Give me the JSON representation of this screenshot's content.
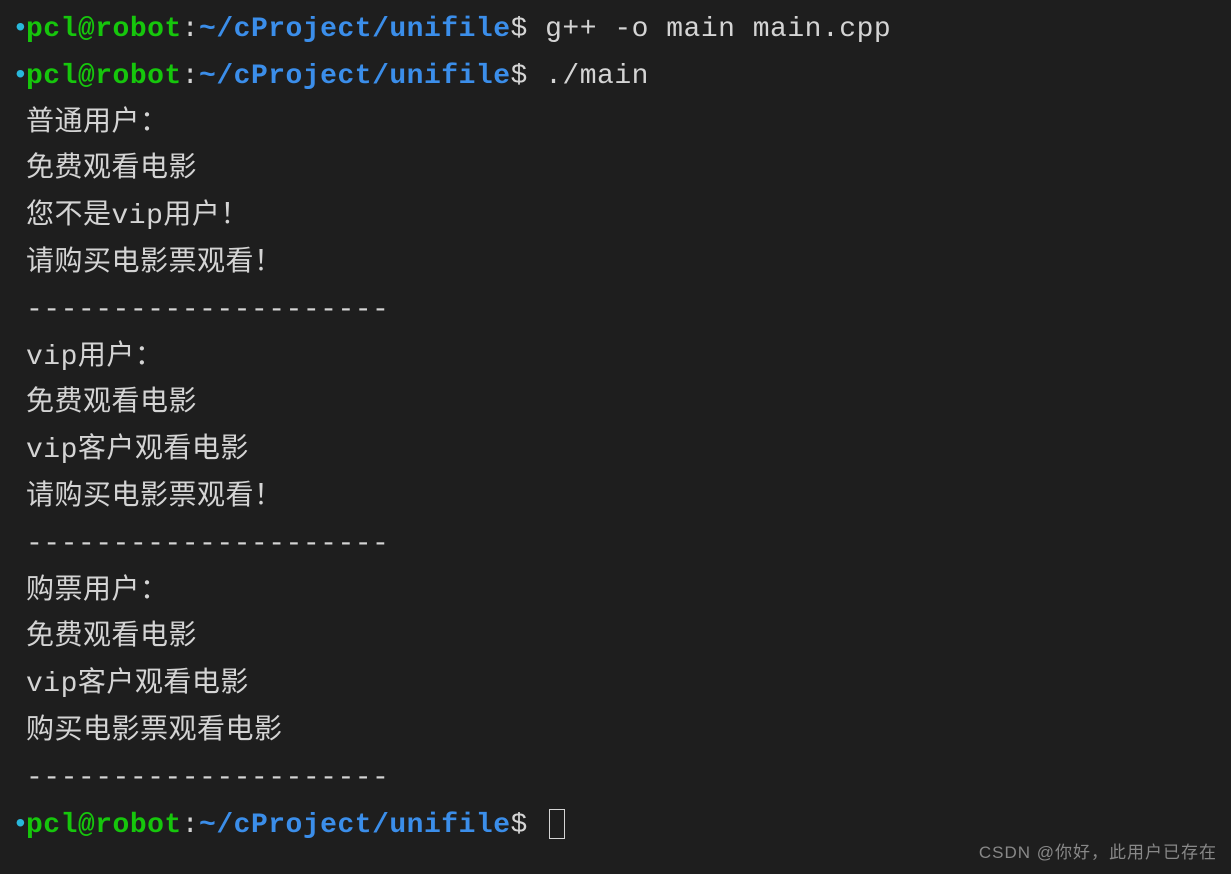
{
  "prompts": [
    {
      "bullet": "•",
      "user_host": "pcl@robot",
      "colon": ":",
      "path": "~/cProject/unifile",
      "dollar": "$",
      "command": "g++ -o main main.cpp"
    },
    {
      "bullet": "•",
      "user_host": "pcl@robot",
      "colon": ":",
      "path": "~/cProject/unifile",
      "dollar": "$",
      "command": "./main"
    }
  ],
  "output_lines": [
    "普通用户：",
    "免费观看电影",
    "您不是vip用户！",
    "请购买电影票观看！",
    "---------------------",
    "vip用户：",
    "免费观看电影",
    "vip客户观看电影",
    "请购买电影票观看！",
    "---------------------",
    "购票用户：",
    "免费观看电影",
    "vip客户观看电影",
    "购买电影票观看电影",
    "---------------------"
  ],
  "final_prompt": {
    "bullet": "•",
    "user_host": "pcl@robot",
    "colon": ":",
    "path": "~/cProject/unifile",
    "dollar": "$"
  },
  "watermark": "CSDN @你好，此用户已存在"
}
